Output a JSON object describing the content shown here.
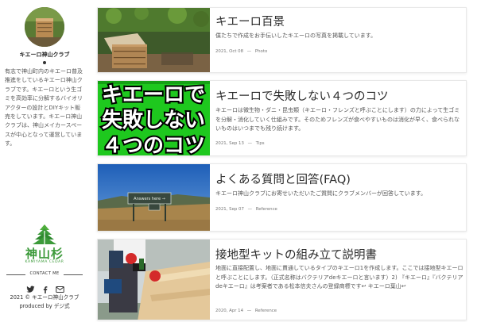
{
  "sidebar": {
    "site_name": "キエーロ神山クラブ",
    "description": "有志で神山町内のキエーロ普及推進をしているキエーロ神山クラブです。キエーロという生ゴミを高効率に分解するバイオリアクターの設計とDIYキット販売をしています。キエーロ神山クラブは、神山メイカースペースが中心となって運営しています。",
    "logo_text": "神山杉",
    "logo_sub": "KAMIYAMA CEDAR",
    "contact_label": "CONTACT ME",
    "social_icons": [
      "twitter-icon",
      "facebook-icon",
      "mail-icon"
    ],
    "copyright": "2021 © キエーロ神山クラブ",
    "produced_by": "produced by デジ式"
  },
  "posts": [
    {
      "title": "キエーロ百景",
      "excerpt": "僕たちで作成をお手伝いしたキエーロの写真を掲載しています。",
      "date": "2021, Oct 08",
      "separator": "—",
      "category": "Photo"
    },
    {
      "title": "キエーロで失敗しない４つのコツ",
      "excerpt": "キエーロは微生物・ダニ・昆虫類（キエーロ・フレンズと呼ぶことにします）の力によって生ゴミを分解・消化していく仕組みです。そのためフレンズが食べやすいものは消化が早く、食べられないものはいつまでも残り続けます。",
      "date": "2021, Sep 13",
      "separator": "—",
      "category": "Tips",
      "thumb_text": [
        "キエーロで",
        "失敗しない",
        "４つのコツ"
      ]
    },
    {
      "title": "よくある質問と回答(FAQ)",
      "excerpt": "キエーロ神山クラブにお寄せいただいたご質問にクラブメンバーが回答しています。",
      "date": "2021, Sep 07",
      "separator": "—",
      "category": "Reference",
      "sign_text": "Answers here →"
    },
    {
      "title": "接地型キットの組み立て説明書",
      "excerpt": "地面に直接配置し、地面に貫通しているタイプのキエーロ1を作成します。ここでは接地型キエーロと呼ぶことにします。（正式名称はバクテリアdeキエーロと言います）2) 『キエーロ』『バクテリアdeキエーロ』は考案者である松本信夫さんの登録商標です↩ キエーロ葉山↩",
      "date": "2020, Apr 14",
      "separator": "—",
      "category": "Reference"
    }
  ],
  "colors": {
    "accent_green": "#3c9a3a",
    "thumb_green": "#1ec81e"
  }
}
